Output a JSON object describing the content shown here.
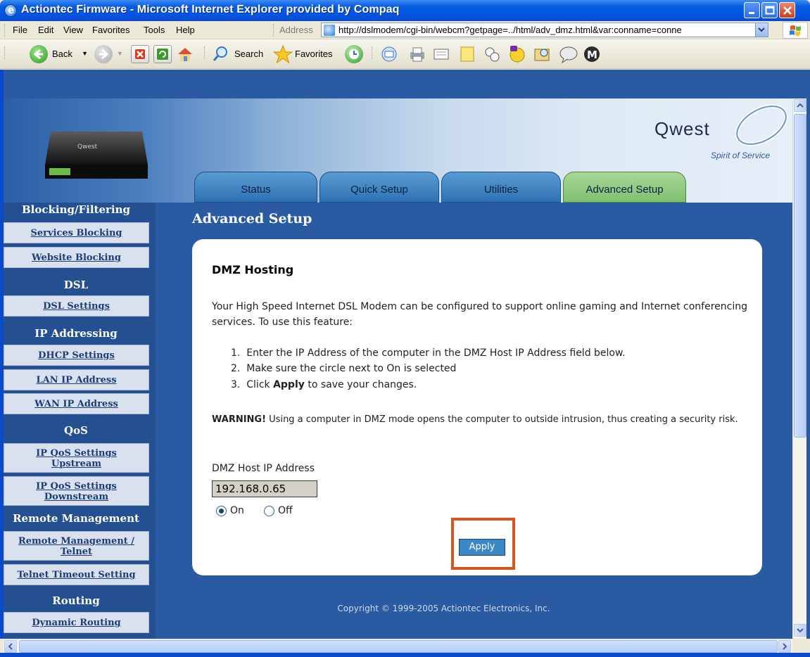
{
  "window": {
    "title": "Actiontec Firmware - Microsoft Internet Explorer provided by Compaq"
  },
  "menubar": {
    "items": [
      "File",
      "Edit",
      "View",
      "Favorites",
      "Tools",
      "Help"
    ],
    "address_label": "Address",
    "address_value": "http://dslmodem/cgi-bin/webcm?getpage=../html/adv_dmz.html&var:conname=conne"
  },
  "toolbar": {
    "back_label": "Back",
    "search_label": "Search",
    "favorites_label": "Favorites"
  },
  "header": {
    "brand": "Qwest",
    "tagline": "Spirit of Service",
    "tabs": [
      {
        "label": "Status",
        "active": false
      },
      {
        "label": "Quick Setup",
        "active": false
      },
      {
        "label": "Utilities",
        "active": false
      },
      {
        "label": "Advanced Setup",
        "active": true
      }
    ]
  },
  "sidebar": {
    "sections": [
      {
        "heading": "Blocking/Filtering",
        "items": [
          "Services Blocking",
          "Website Blocking"
        ]
      },
      {
        "heading": "DSL",
        "items": [
          "DSL Settings"
        ]
      },
      {
        "heading": "IP Addressing",
        "items": [
          "DHCP Settings",
          "LAN IP Address",
          "WAN IP Address"
        ]
      },
      {
        "heading": "QoS",
        "items": [
          "IP QoS Settings Upstream",
          "IP QoS Settings Downstream"
        ]
      },
      {
        "heading": "Remote Management",
        "items": [
          "Remote Management / Telnet",
          "Telnet Timeout Setting"
        ]
      },
      {
        "heading": "Routing",
        "items": [
          "Dynamic Routing"
        ]
      }
    ]
  },
  "main": {
    "page_title": "Advanced Setup",
    "card_title": "DMZ Hosting",
    "intro": "Your High Speed Internet DSL Modem can be configured to support online gaming and Internet conferencing services. To use this feature:",
    "steps": [
      {
        "num": "1.",
        "text": "Enter the IP Address of the computer in the DMZ Host IP Address field below."
      },
      {
        "num": "2.",
        "text": "Make sure the circle next to On is selected"
      },
      {
        "num": "3.",
        "pre": "Click ",
        "bold": "Apply",
        "post": " to save your changes."
      }
    ],
    "warning_bold": "WARNING!",
    "warning_text": " Using a computer in DMZ mode opens the computer to outside intrusion, thus creating a security risk.",
    "ip_label": "DMZ Host IP Address",
    "ip_value": "192.168.0.65",
    "radio_on_label": "On",
    "radio_off_label": "Off",
    "dmz_state": "On",
    "apply_label": "Apply"
  },
  "footer": {
    "copyright": "Copyright © 1999-2005 Actiontec Electronics, Inc."
  },
  "colors": {
    "page_bg": "#2a5aa1",
    "nav_bg": "#244f91",
    "active_tab": "#8cc77a",
    "highlight": "#d9541e"
  }
}
